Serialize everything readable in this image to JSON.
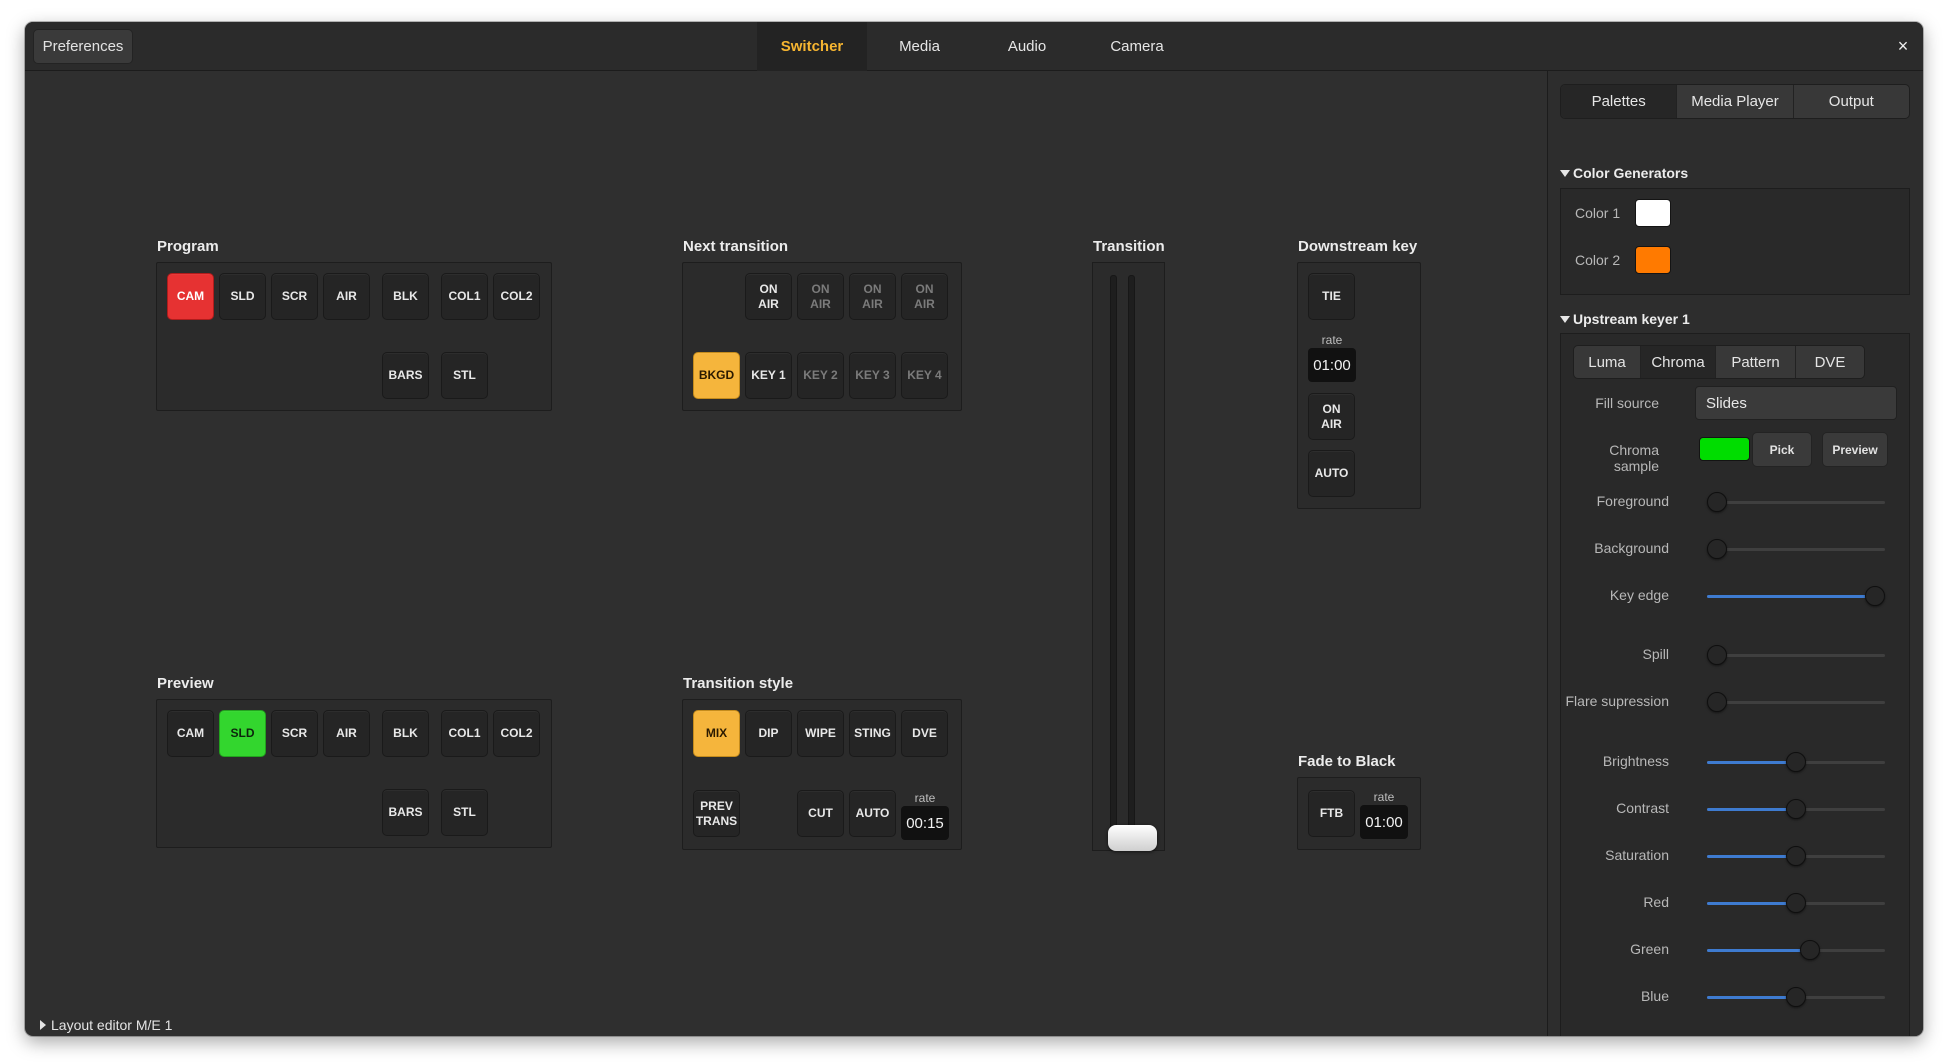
{
  "header": {
    "preferences_label": "Preferences",
    "tabs": [
      "Switcher",
      "Media",
      "Audio",
      "Camera"
    ],
    "active_tab": "Switcher",
    "close_glyph": "×"
  },
  "program": {
    "title": "Program",
    "row1": [
      "CAM",
      "SLD",
      "SCR",
      "AIR",
      "BLK",
      "COL1",
      "COL2"
    ],
    "row2": [
      "BARS",
      "STL"
    ],
    "active": "CAM"
  },
  "preview": {
    "title": "Preview",
    "row1": [
      "CAM",
      "SLD",
      "SCR",
      "AIR",
      "BLK",
      "COL1",
      "COL2"
    ],
    "row2": [
      "BARS",
      "STL"
    ],
    "active": "SLD"
  },
  "next_transition": {
    "title": "Next transition",
    "on_air": [
      "ON\nAIR",
      "ON\nAIR",
      "ON\nAIR",
      "ON\nAIR"
    ],
    "layers": [
      "BKGD",
      "KEY 1",
      "KEY 2",
      "KEY 3",
      "KEY 4"
    ]
  },
  "transition": {
    "title": "Transition"
  },
  "transition_style": {
    "title": "Transition style",
    "styles": [
      "MIX",
      "DIP",
      "WIPE",
      "STING",
      "DVE"
    ],
    "prev_trans": "PREV\nTRANS",
    "cut": "CUT",
    "auto": "AUTO",
    "rate_label": "rate",
    "rate": "00:15"
  },
  "downstream_key": {
    "title": "Downstream key",
    "tie": "TIE",
    "rate_label": "rate",
    "rate": "01:00",
    "on_air": "ON\nAIR",
    "auto": "AUTO"
  },
  "fade_to_black": {
    "title": "Fade to Black",
    "ftb": "FTB",
    "rate_label": "rate",
    "rate": "01:00"
  },
  "sidebar": {
    "tabs": [
      "Palettes",
      "Media Player",
      "Output"
    ],
    "color_generators": {
      "title": "Color Generators",
      "items": [
        {
          "label": "Color 1",
          "color": "#ffffff"
        },
        {
          "label": "Color 2",
          "color": "#ff7a00"
        }
      ]
    },
    "upstream_keyer": {
      "title": "Upstream keyer 1",
      "tabs": [
        "Luma",
        "Chroma",
        "Pattern",
        "DVE"
      ],
      "active_tab": "Chroma",
      "fill_source_label": "Fill source",
      "fill_source_value": "Slides",
      "chroma_sample_label": "Chroma sample",
      "chroma_sample_color": "#00dd00",
      "pick_label": "Pick",
      "preview_label": "Preview",
      "sliders": [
        {
          "label": "Foreground",
          "value": 0.0
        },
        {
          "label": "Background",
          "value": 0.0
        },
        {
          "label": "Key edge",
          "value": 1.0
        },
        {
          "label": "Spill",
          "value": 0.0
        },
        {
          "label": "Flare supression",
          "value": 0.0
        },
        {
          "label": "Brightness",
          "value": 0.5
        },
        {
          "label": "Contrast",
          "value": 0.5
        },
        {
          "label": "Saturation",
          "value": 0.5
        },
        {
          "label": "Red",
          "value": 0.5
        },
        {
          "label": "Green",
          "value": 0.58
        },
        {
          "label": "Blue",
          "value": 0.5
        }
      ]
    }
  },
  "footer": {
    "label": "Layout editor M/E 1"
  },
  "colors": {
    "accent": "#f6b531",
    "program_active": "#e63232",
    "preview_active": "#33d62e",
    "transition_active": "#f5b53c",
    "slider_fill": "#3e7bd0"
  }
}
